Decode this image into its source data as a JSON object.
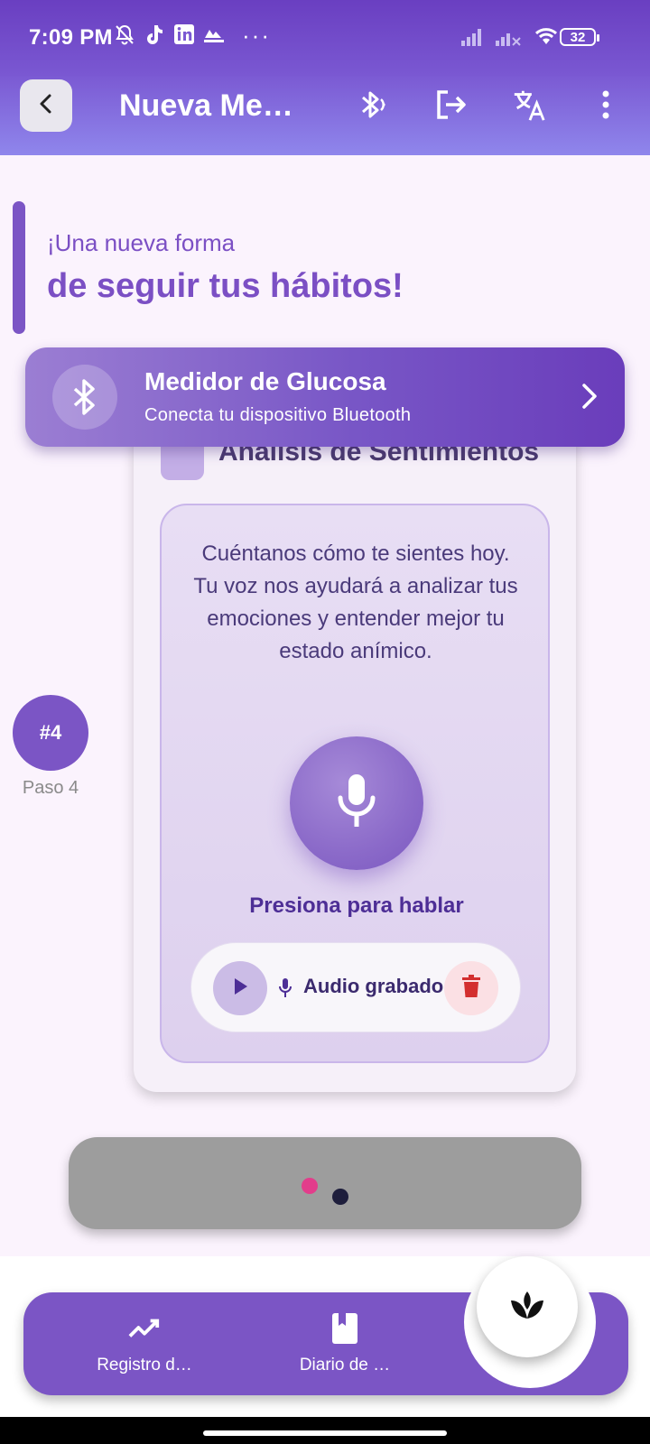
{
  "status_bar": {
    "time": "7:09 PM",
    "more": "···",
    "battery": "32",
    "icons": [
      "notifications-off-icon",
      "tiktok-icon",
      "linkedin-icon",
      "app-icon",
      "signal-icon",
      "signal-x-icon",
      "wifi-icon",
      "battery-icon"
    ]
  },
  "app_bar": {
    "title": "Nueva Me…",
    "icons": [
      "back-icon",
      "bluetooth-searching-icon",
      "logout-icon",
      "translate-icon",
      "more-vert-icon"
    ]
  },
  "hero": {
    "line1": "¡Una nueva forma",
    "line2": "de seguir tus hábitos!"
  },
  "glucose_banner": {
    "title": "Medidor de Glucosa",
    "subtitle": "Conecta tu dispositivo Bluetooth"
  },
  "card": {
    "title": "Análisis de Sentimientos",
    "prompt": "Cuéntanos cómo te sientes hoy. Tu voz nos ayudará a analizar tus emociones y entender mejor tu estado anímico.",
    "press_label": "Presiona para hablar",
    "audio_label": "Audio grabado"
  },
  "step": {
    "badge": "#4",
    "label": "Paso 4"
  },
  "bottom_nav": {
    "items": [
      {
        "label": "Registro d…",
        "icon": "trending-up-icon"
      },
      {
        "label": "Diario de …",
        "icon": "book-icon"
      }
    ],
    "fab_icon": "lotus-icon"
  },
  "colors": {
    "primary": "#7b55c5",
    "app_bar": "#7b5ad3",
    "background": "#fbf3fd",
    "delete": "#d32f2f",
    "dot_active": "#e23d8b"
  }
}
